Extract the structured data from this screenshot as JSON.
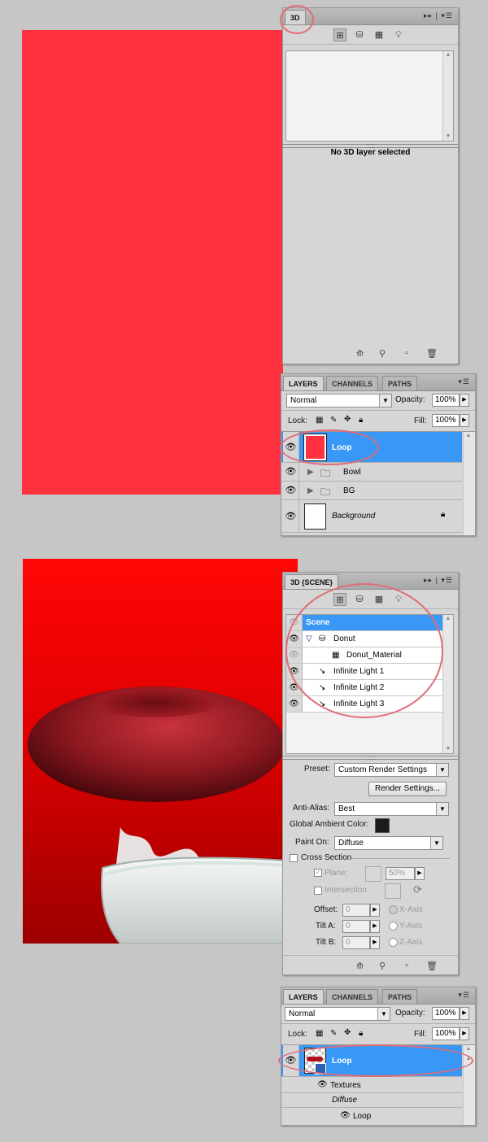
{
  "top_panel_3d": {
    "tab": "3D",
    "status": "No 3D layer selected"
  },
  "layers_panel_1": {
    "tabs": [
      "LAYERS",
      "CHANNELS",
      "PATHS"
    ],
    "blend_mode": "Normal",
    "opacity_label": "Opacity:",
    "opacity_value": "100%",
    "lock_label": "Lock:",
    "fill_label": "Fill:",
    "fill_value": "100%",
    "layers": [
      {
        "name": "Loop"
      },
      {
        "name": "Bowl"
      },
      {
        "name": "BG"
      },
      {
        "name": "Background"
      }
    ]
  },
  "scene_panel": {
    "tab": "3D {SCENE}",
    "tree": [
      {
        "name": "Scene"
      },
      {
        "name": "Donut"
      },
      {
        "name": "Donut_Material"
      },
      {
        "name": "Infinite Light 1"
      },
      {
        "name": "Infinite Light 2"
      },
      {
        "name": "Infinite Light 3"
      }
    ],
    "preset_label": "Preset:",
    "preset_value": "Custom Render Settings",
    "render_settings_button": "Render Settings...",
    "anti_alias_label": "Anti-Alias:",
    "anti_alias_value": "Best",
    "global_ambient_label": "Global Ambient Color:",
    "paint_on_label": "Paint On:",
    "paint_on_value": "Diffuse",
    "cross_section_label": "Cross Section",
    "plane_label": "Plane:",
    "plane_value": "50%",
    "intersection_label": "Intersection:",
    "offset_label": "Offset:",
    "offset_value": "0",
    "tilt_a_label": "Tilt A:",
    "tilt_a_value": "0",
    "tilt_b_label": "Tilt B:",
    "tilt_b_value": "0",
    "x_axis": "X-Axis",
    "y_axis": "Y-Axis",
    "z_axis": "Z-Axis"
  },
  "layers_panel_2": {
    "tabs": [
      "LAYERS",
      "CHANNELS",
      "PATHS"
    ],
    "blend_mode": "Normal",
    "opacity_label": "Opacity:",
    "opacity_value": "100%",
    "lock_label": "Lock:",
    "fill_label": "Fill:",
    "fill_value": "100%",
    "layer_name": "Loop",
    "textures_label": "Textures",
    "diffuse_label": "Diffuse",
    "texture_layer": "Loop"
  },
  "colors": {
    "canvas_red": "#ff3340",
    "selection_blue": "#3997f5",
    "annotation_circle": "#e06d77"
  }
}
